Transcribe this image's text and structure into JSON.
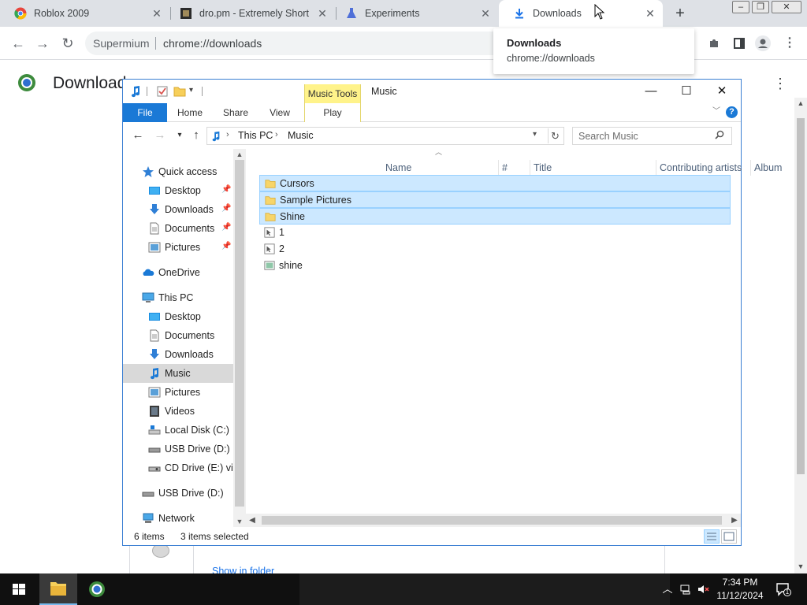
{
  "browser": {
    "tabs": [
      {
        "title": "Roblox 2009",
        "active": false
      },
      {
        "title": "dro.pm - Extremely Short",
        "active": false
      },
      {
        "title": "Experiments",
        "active": false
      },
      {
        "title": "Downloads",
        "active": true
      }
    ],
    "omnibox": {
      "brand": "Supermium",
      "url": "chrome://downloads"
    },
    "popup": {
      "title": "Downloads",
      "url": "chrome://downloads"
    },
    "page_title": "Downloads",
    "show_in_folder": "Show in folder"
  },
  "explorer": {
    "caption": "Music",
    "context_tab": "Music Tools",
    "ribbon_tabs": [
      "File",
      "Home",
      "Share",
      "View"
    ],
    "context_subtab": "Play",
    "breadcrumb": [
      "This PC",
      "Music"
    ],
    "search_placeholder": "Search Music",
    "nav": {
      "quick_access": "Quick access",
      "qa_items": [
        "Desktop",
        "Downloads",
        "Documents",
        "Pictures"
      ],
      "onedrive": "OneDrive",
      "this_pc": "This PC",
      "pc_items": [
        "Desktop",
        "Documents",
        "Downloads",
        "Music",
        "Pictures",
        "Videos",
        "Local Disk (C:)",
        "USB Drive (D:)",
        "CD Drive (E:) virt"
      ],
      "usb": "USB Drive (D:)",
      "network": "Network",
      "selected": "Music"
    },
    "columns": [
      "Name",
      "#",
      "Title",
      "Contributing artists",
      "Album"
    ],
    "rows": [
      {
        "name": "Cursors",
        "type": "folder",
        "selected": true
      },
      {
        "name": "Sample Pictures",
        "type": "folder",
        "selected": true
      },
      {
        "name": "Shine",
        "type": "folder",
        "selected": true
      },
      {
        "name": "1",
        "type": "file",
        "selected": false
      },
      {
        "name": "2",
        "type": "file",
        "selected": false
      },
      {
        "name": "shine",
        "type": "image",
        "selected": false
      }
    ],
    "status": {
      "count": "6 items",
      "selection": "3 items selected"
    }
  },
  "taskbar": {
    "time": "7:34 PM",
    "date": "11/12/2024",
    "notifications": "1"
  },
  "colors": {
    "accent": "#1a79d6",
    "selection": "#cce8ff",
    "context_tab": "#fff38a"
  }
}
